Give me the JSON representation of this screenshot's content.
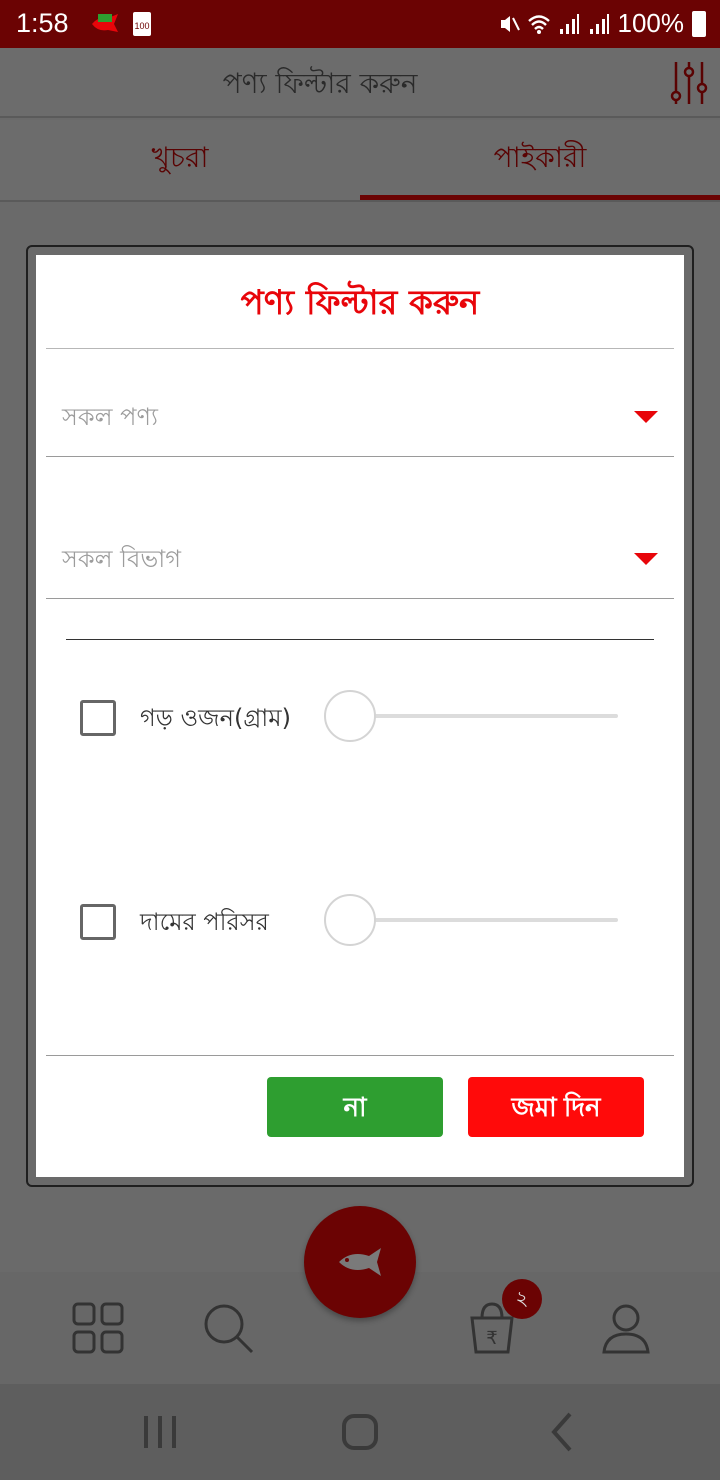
{
  "status_bar": {
    "time": "1:58",
    "battery_small": "100",
    "battery_percent": "100%",
    "icons": [
      "app-icon",
      "mute-icon",
      "wifi-icon",
      "signal-icon",
      "signal-icon",
      "battery-icon"
    ]
  },
  "header": {
    "title": "পণ্য ফিল্টার করুন",
    "filter_icon": "sliders-icon"
  },
  "tabs": [
    {
      "label": "খুচরা",
      "active": false
    },
    {
      "label": "পাইকারী",
      "active": true
    }
  ],
  "dialog": {
    "title": "পণ্য ফিল্টার করুন",
    "product_select": {
      "value": "সকল পণ্য"
    },
    "division_select": {
      "value": "সকল বিভাগ"
    },
    "weight": {
      "label": "গড় ওজন(গ্রাম)",
      "checked": false,
      "slider_value": 0
    },
    "price": {
      "label": "দামের পরিসর",
      "checked": false,
      "slider_value": 0
    },
    "no_button": "না",
    "submit_button": "জমা দিন"
  },
  "bottom_nav": {
    "items": [
      "grid-icon",
      "search-icon",
      "fish-icon",
      "cart-icon",
      "profile-icon"
    ],
    "cart_badge": "২"
  },
  "colors": {
    "accent_red": "#e8050a",
    "dark_red": "#6b0303",
    "green": "#2e9e30"
  }
}
